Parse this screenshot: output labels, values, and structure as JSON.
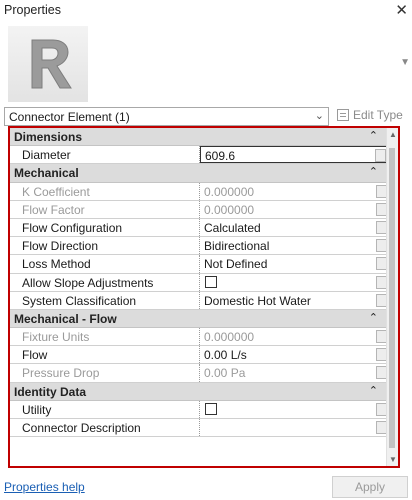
{
  "titlebar": {
    "title": "Properties",
    "close": "✕"
  },
  "type_image": {
    "icon": "revit-r-logo",
    "dropdown": "▼"
  },
  "selector": {
    "value": "Connector Element (1)",
    "chevron": "⌄",
    "edit_type_label": "Edit Type"
  },
  "groups": [
    {
      "label": "Dimensions",
      "rows": [
        {
          "name": "Diameter",
          "value": "609.6",
          "disabled": false,
          "editing": true
        }
      ]
    },
    {
      "label": "Mechanical",
      "rows": [
        {
          "name": "K Coefficient",
          "value": "0.000000",
          "disabled": true
        },
        {
          "name": "Flow Factor",
          "value": "0.000000",
          "disabled": true
        },
        {
          "name": "Flow Configuration",
          "value": "Calculated",
          "disabled": false
        },
        {
          "name": "Flow Direction",
          "value": "Bidirectional",
          "disabled": false
        },
        {
          "name": "Loss Method",
          "value": "Not Defined",
          "disabled": false
        },
        {
          "name": "Allow Slope Adjustments",
          "value": "",
          "checkbox": true,
          "disabled": false
        },
        {
          "name": "System Classification",
          "value": "Domestic Hot Water",
          "disabled": false
        }
      ]
    },
    {
      "label": "Mechanical - Flow",
      "rows": [
        {
          "name": "Fixture Units",
          "value": "0.000000",
          "disabled": true
        },
        {
          "name": "Flow",
          "value": "0.00 L/s",
          "disabled": false
        },
        {
          "name": "Pressure Drop",
          "value": "0.00 Pa",
          "disabled": true
        }
      ]
    },
    {
      "label": "Identity Data",
      "rows": [
        {
          "name": "Utility",
          "value": "",
          "checkbox": true,
          "disabled": false
        },
        {
          "name": "Connector Description",
          "value": "",
          "disabled": false
        }
      ]
    }
  ],
  "collapse_icon": "⌃",
  "footer": {
    "help_link": "Properties help",
    "apply_label": "Apply"
  },
  "colors": {
    "highlight_border": "#c00000",
    "group_bg": "#dcdcdc",
    "link": "#1a5fb4"
  }
}
